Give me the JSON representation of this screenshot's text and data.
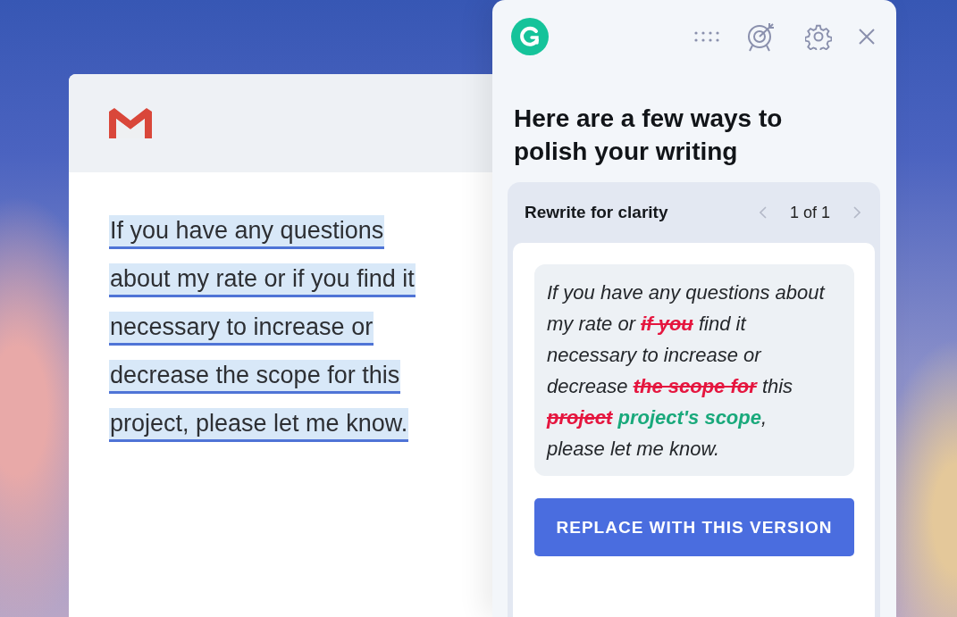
{
  "email": {
    "lines": [
      "If you have any questions",
      "about my rate or if you find it",
      "necessary to increase or",
      "decrease the scope for this",
      "project, please let me know."
    ]
  },
  "assistant": {
    "heading": "Here are a few ways to polish your writing",
    "card": {
      "title": "Rewrite for clarity",
      "counter": "1 of 1",
      "suggestion": [
        {
          "kind": "plain",
          "text": "If you have any questions about my rate or "
        },
        {
          "kind": "deleted",
          "text": "if you"
        },
        {
          "kind": "plain",
          "text": " find it necessary to increase or decrease "
        },
        {
          "kind": "deleted",
          "text": "the scope for"
        },
        {
          "kind": "plain",
          "text": " this "
        },
        {
          "kind": "deleted",
          "text": "project"
        },
        {
          "kind": "inserted",
          "text": " project's scope"
        },
        {
          "kind": "plain",
          "text": ", please let me know."
        }
      ],
      "button": "REPLACE WITH THIS VERSION"
    }
  }
}
